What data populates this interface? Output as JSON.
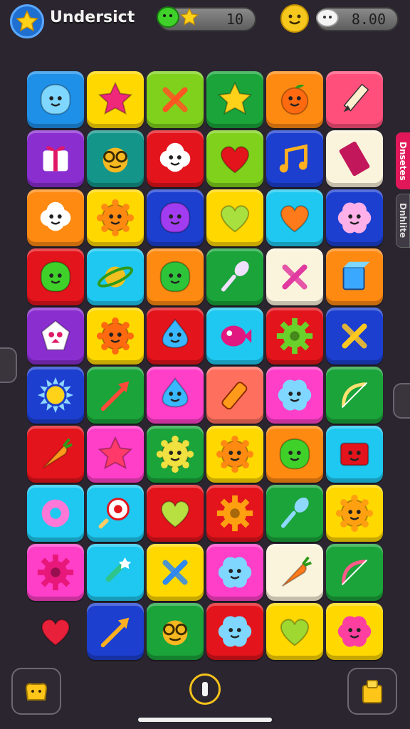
{
  "header": {
    "title": "Undersict",
    "currency_left": "10",
    "currency_right": "8.00"
  },
  "side_tabs": {
    "tab_1": "Dnsetes",
    "tab_2": "Dnhlite"
  },
  "colors": {
    "blue": "#1e90e8",
    "yellow": "#ffd800",
    "lime": "#7fd11b",
    "green": "#1aa43a",
    "orange": "#ff8a12",
    "pink": "#ff4f7a",
    "purple": "#8a2ed0",
    "teal": "#13958a",
    "red": "#e3141c",
    "navy": "#1c3fd0",
    "cream": "#fbf4dc",
    "cyan": "#1ec8f0",
    "magenta": "#ff3fc8",
    "salmon": "#ff6f5e"
  },
  "board": {
    "rows": [
      [
        {
          "bg": "blue",
          "icon": "blob-face-icon",
          "c": "#7fd7ff"
        },
        {
          "bg": "yellow",
          "icon": "star-icon",
          "c": "#f0287a"
        },
        {
          "bg": "lime",
          "icon": "crossed-tools-icon",
          "c": "#ff5522"
        },
        {
          "bg": "green",
          "icon": "star-icon",
          "c": "#ffd21a"
        },
        {
          "bg": "orange",
          "icon": "orange-fruit-icon",
          "c": "#ff6a10"
        },
        {
          "bg": "pink",
          "icon": "pencil-icon",
          "c": "#fff0d0"
        }
      ],
      [
        {
          "bg": "purple",
          "icon": "gift-box-icon",
          "c": "#ffffff"
        },
        {
          "bg": "teal",
          "icon": "goggles-face-icon",
          "c": "#f5b820"
        },
        {
          "bg": "red",
          "icon": "cloud-face-icon",
          "c": "#ffffff"
        },
        {
          "bg": "lime",
          "icon": "heart-icon",
          "c": "#e3141c"
        },
        {
          "bg": "navy",
          "icon": "music-note-icon",
          "c": "#ffb020"
        },
        {
          "bg": "cream",
          "icon": "chocolate-bar-icon",
          "c": "#c2185b"
        }
      ],
      [
        {
          "bg": "orange",
          "icon": "cloud-face-icon",
          "c": "#ffffff"
        },
        {
          "bg": "yellow",
          "icon": "sun-face-icon",
          "c": "#ff8a12"
        },
        {
          "bg": "navy",
          "icon": "blob-face-icon",
          "c": "#a23cf0"
        },
        {
          "bg": "yellow",
          "icon": "heart-icon",
          "c": "#a8e040"
        },
        {
          "bg": "cyan",
          "icon": "heart-icon",
          "c": "#ff7a1a"
        },
        {
          "bg": "navy",
          "icon": "flower-face-icon",
          "c": "#ffb0e8"
        }
      ],
      [
        {
          "bg": "red",
          "icon": "blob-face-icon",
          "c": "#3fd12a"
        },
        {
          "bg": "cyan",
          "icon": "planet-icon",
          "c": "#f0c020"
        },
        {
          "bg": "orange",
          "icon": "blob-face-icon",
          "c": "#2ec43a"
        },
        {
          "bg": "green",
          "icon": "spoon-icon",
          "c": "#f0e0ff"
        },
        {
          "bg": "cream",
          "icon": "crossed-tools-icon",
          "c": "#e03aa0"
        },
        {
          "bg": "orange",
          "icon": "cube-icon",
          "c": "#3aa8ff"
        }
      ],
      [
        {
          "bg": "purple",
          "icon": "gem-face-icon",
          "c": "#ffffff"
        },
        {
          "bg": "yellow",
          "icon": "sun-face-icon",
          "c": "#ff6a10"
        },
        {
          "bg": "red",
          "icon": "drop-face-icon",
          "c": "#3ab8ff"
        },
        {
          "bg": "cyan",
          "icon": "fish-icon",
          "c": "#e01880"
        },
        {
          "bg": "red",
          "icon": "gear-icon",
          "c": "#6ad12a"
        },
        {
          "bg": "navy",
          "icon": "crossed-tools-icon",
          "c": "#ffc820"
        }
      ],
      [
        {
          "bg": "navy",
          "icon": "sun-icon",
          "c": "#ffd21a"
        },
        {
          "bg": "green",
          "icon": "arrow-icon",
          "c": "#ff4a3a"
        },
        {
          "bg": "magenta",
          "icon": "drop-face-icon",
          "c": "#3ab8ff"
        },
        {
          "bg": "salmon",
          "icon": "bottle-icon",
          "c": "#ff9a1a"
        },
        {
          "bg": "magenta",
          "icon": "flower-face-icon",
          "c": "#7fd7ff"
        },
        {
          "bg": "green",
          "icon": "bow-icon",
          "c": "#ffe070"
        }
      ],
      [
        {
          "bg": "red",
          "icon": "carrot-icon",
          "c": "#ff9a1a"
        },
        {
          "bg": "magenta",
          "icon": "star-icon",
          "c": "#ff3a6a"
        },
        {
          "bg": "green",
          "icon": "sun-face-icon",
          "c": "#f0e040"
        },
        {
          "bg": "yellow",
          "icon": "sun-face-icon",
          "c": "#ff8a12"
        },
        {
          "bg": "orange",
          "icon": "blob-face-icon",
          "c": "#3fd12a"
        },
        {
          "bg": "cyan",
          "icon": "box-face-icon",
          "c": "#e3141c"
        }
      ],
      [
        {
          "bg": "cyan",
          "icon": "donut-icon",
          "c": "#ff78d8"
        },
        {
          "bg": "cyan",
          "icon": "lollipop-icon",
          "c": "#ffffff"
        },
        {
          "bg": "red",
          "icon": "heart-icon",
          "c": "#b8e040"
        },
        {
          "bg": "red",
          "icon": "gear-icon",
          "c": "#ffa010"
        },
        {
          "bg": "green",
          "icon": "spoon-icon",
          "c": "#8fd8ff"
        },
        {
          "bg": "yellow",
          "icon": "sun-face-icon",
          "c": "#ffa010"
        }
      ],
      [
        {
          "bg": "magenta",
          "icon": "gear-icon",
          "c": "#e8187a"
        },
        {
          "bg": "cyan",
          "icon": "wand-icon",
          "c": "#2ec48a"
        },
        {
          "bg": "yellow",
          "icon": "crossed-tools-icon",
          "c": "#2e88f0"
        },
        {
          "bg": "magenta",
          "icon": "flower-face-icon",
          "c": "#7fd7ff"
        },
        {
          "bg": "cream",
          "icon": "carrot-icon",
          "c": "#ff7a1a"
        },
        {
          "bg": "green",
          "icon": "bow-icon",
          "c": "#ff5a8a"
        }
      ],
      [
        {
          "bg": "none",
          "icon": "heart-icon",
          "c": "#e8203a"
        },
        {
          "bg": "navy",
          "icon": "arrow-icon",
          "c": "#ffb020"
        },
        {
          "bg": "green",
          "icon": "goggles-face-icon",
          "c": "#f5b820"
        },
        {
          "bg": "red",
          "icon": "flower-face-icon",
          "c": "#7fd7ff"
        },
        {
          "bg": "yellow",
          "icon": "heart-icon",
          "c": "#9ed830"
        },
        {
          "bg": "yellow",
          "icon": "flower-face-icon",
          "c": "#ff3fa0"
        }
      ]
    ]
  }
}
